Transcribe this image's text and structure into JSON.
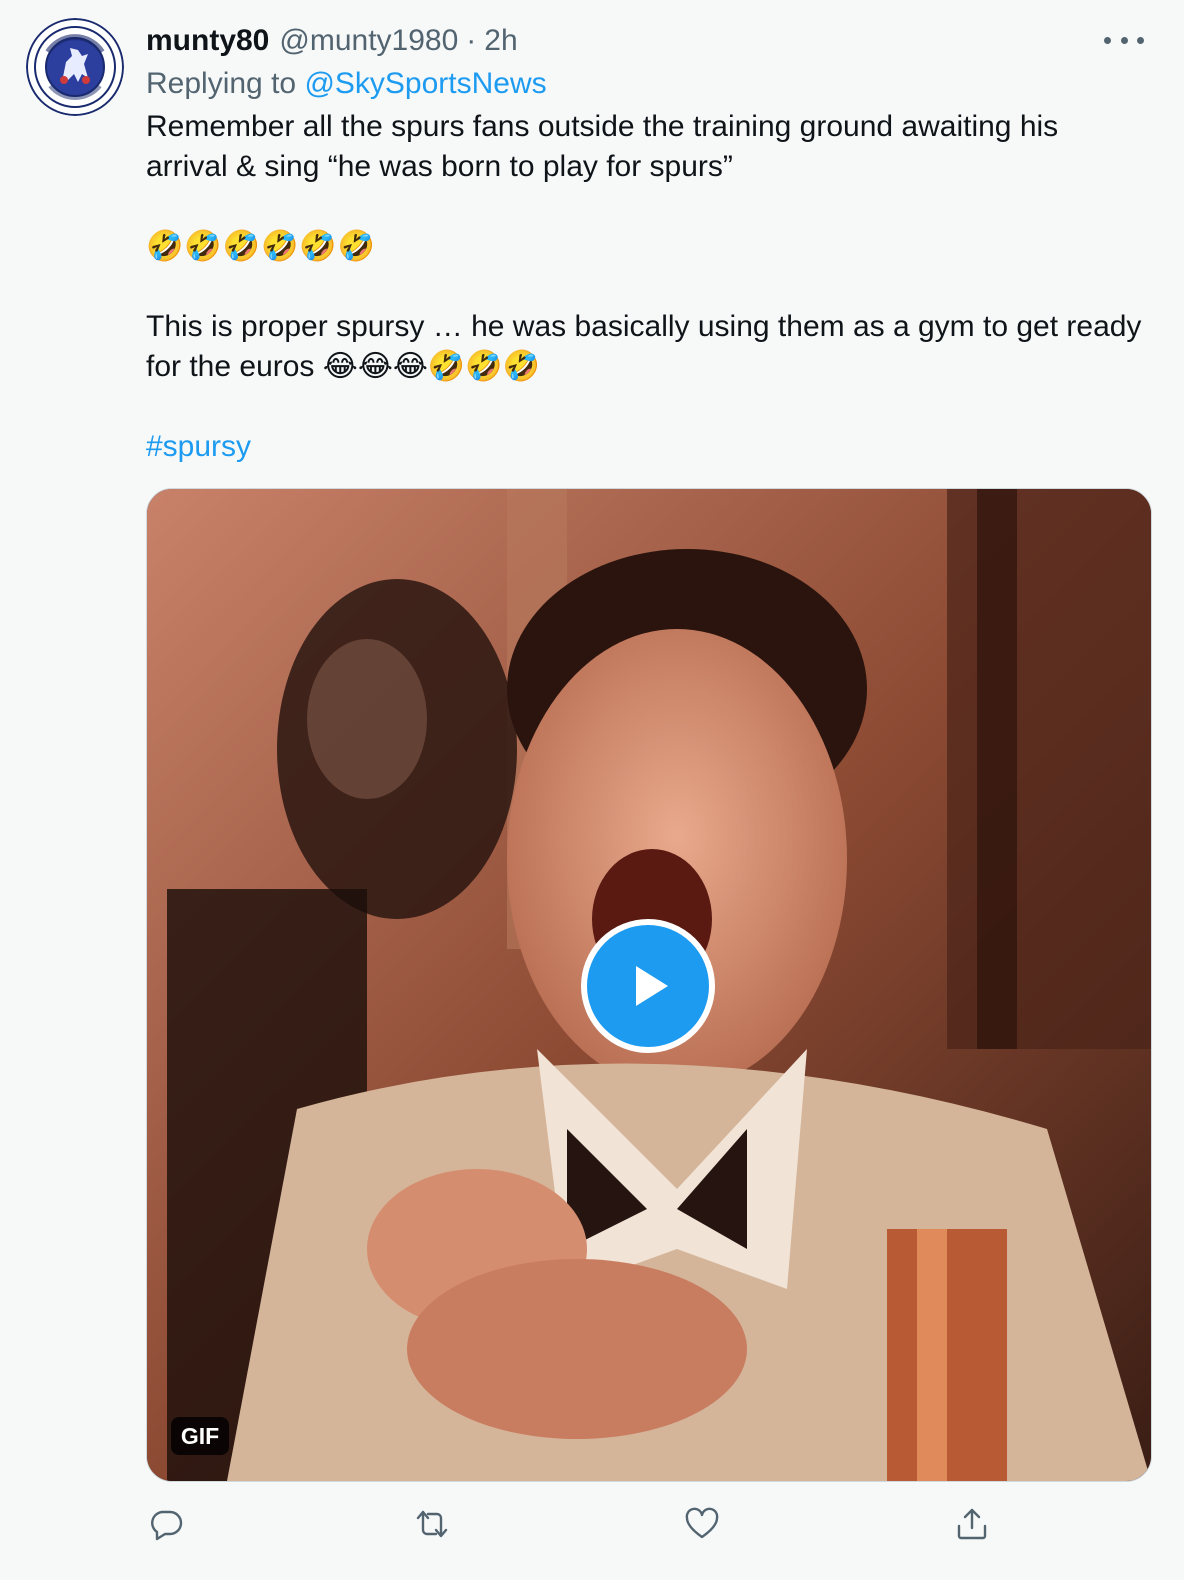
{
  "author": {
    "display_name": "munty80",
    "handle": "@munty1980",
    "separator": "·",
    "time": "2h",
    "avatar": "chelsea-football-club-crest"
  },
  "reply": {
    "prefix": "Replying to",
    "target": "@SkySportsNews"
  },
  "body": {
    "line1": "Remember all the spurs fans outside the training ground awaiting his arrival & sing “he was born to play for spurs”",
    "emojis": "🤣🤣🤣🤣🤣🤣",
    "line2": "This is proper spursy … he was basically using them as a gym to get ready for the euros 😂😂😂🤣🤣🤣",
    "hashtag": "#spursy"
  },
  "media": {
    "badge": "GIF",
    "play_icon": "play-icon"
  },
  "actions": [
    "reply-icon",
    "retweet-icon",
    "like-icon",
    "share-icon"
  ],
  "colors": {
    "link": "#1d9bf0",
    "secondary_text": "#536471",
    "primary_text": "#0f1419",
    "background": "#f7f9f9"
  }
}
